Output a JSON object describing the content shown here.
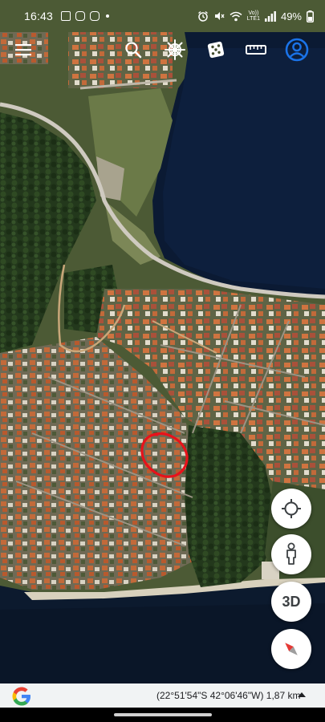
{
  "status_bar": {
    "time": "16:43",
    "notification_icons": [
      "image-icon",
      "instagram-icon",
      "instagram-icon",
      "dot-icon"
    ],
    "system_icons": [
      "alarm-icon",
      "mute-icon",
      "wifi-icon",
      "volte-icon",
      "signal-icon"
    ],
    "volte_label_top": "Vo))",
    "volte_label_bottom": "LTE1",
    "battery": "49%"
  },
  "toolbar": {
    "buttons": [
      {
        "name": "menu",
        "icon": "menu-icon"
      },
      {
        "name": "search",
        "icon": "search-icon"
      },
      {
        "name": "voyager",
        "icon": "ship-wheel-icon"
      },
      {
        "name": "feeling-lucky",
        "icon": "dice-icon"
      },
      {
        "name": "measure",
        "icon": "ruler-icon"
      },
      {
        "name": "account",
        "icon": "account-icon"
      }
    ],
    "accent_color": "#1a73e8"
  },
  "map": {
    "type": "satellite",
    "annotation_color": "#e8121b"
  },
  "floating_buttons": {
    "my_location_icon": "crosshair-icon",
    "street_view_icon": "pegman-icon",
    "three_d_label": "3D",
    "compass_icon": "compass-icon"
  },
  "bottom_bar": {
    "logo": "google-g-logo",
    "coordinates": "(22°51'54\"S 42°06'46\"W) 1,87 km",
    "expand_icon": "triangle-up-icon"
  }
}
